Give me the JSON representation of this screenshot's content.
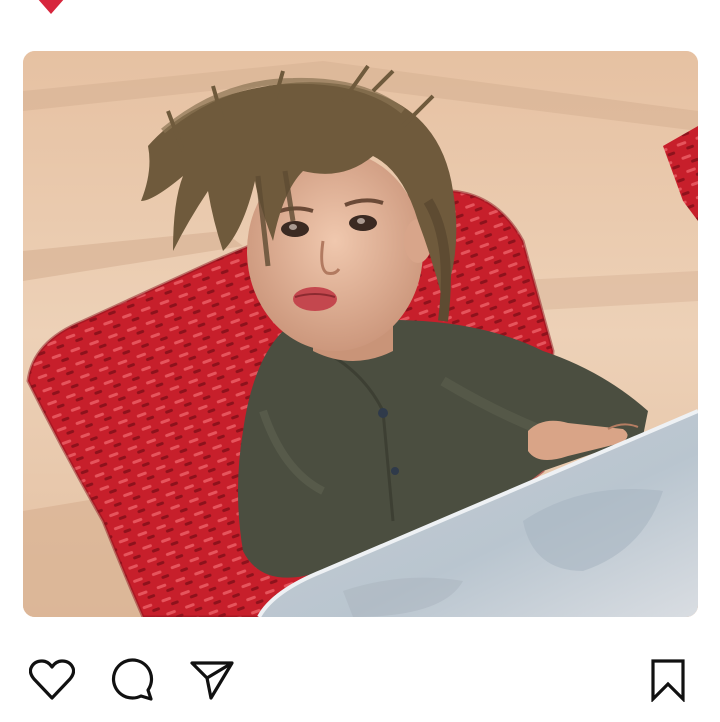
{
  "post": {
    "image_description_alt": "",
    "image": {
      "subject": "child-on-red-chair"
    }
  },
  "actions": {
    "like_icon": "heart-outline-icon",
    "comment_icon": "speech-bubble-icon",
    "share_icon": "paper-plane-icon",
    "save_icon": "bookmark-icon"
  },
  "colors": {
    "background": "#ffffff",
    "icon": "#111111",
    "like_red": "#d7263d",
    "chair_red": "#c9202c",
    "sand": "#e6c3a4",
    "shirt": "#4a4d3e",
    "hair": "#6f5a3c",
    "skin": "#e2b293"
  }
}
